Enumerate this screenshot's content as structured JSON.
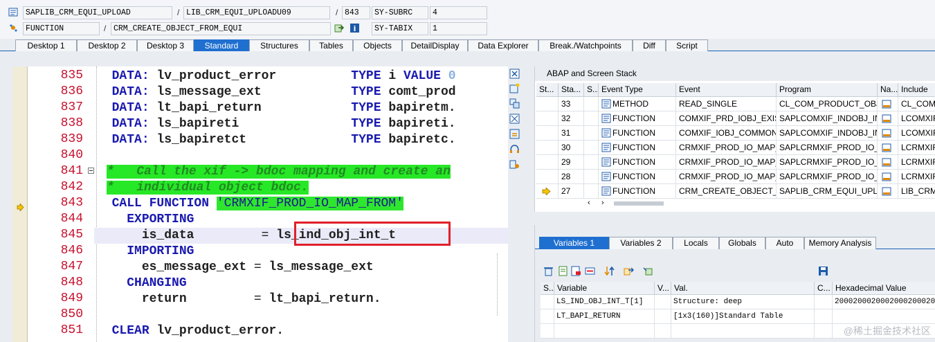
{
  "header": {
    "row1": {
      "program": "SAPLIB_CRM_EQUI_UPLOAD",
      "include": "LIB_CRM_EQUI_UPLOADU09",
      "line": "843",
      "sysfield": "SY-SUBRC",
      "sysvalue": "4",
      "sep1": "/",
      "sep2": "/"
    },
    "row2": {
      "event_type": "FUNCTION",
      "event": "CRM_CREATE_OBJECT_FROM_EQUI",
      "sysfield": "SY-TABIX",
      "sysvalue": "1",
      "sep1": "/"
    }
  },
  "tabs": [
    "Desktop 1",
    "Desktop 2",
    "Desktop 3",
    "Standard",
    "Structures",
    "Tables",
    "Objects",
    "DetailDisplay",
    "Data Explorer",
    "Break./Watchpoints",
    "Diff",
    "Script"
  ],
  "active_tab": "Standard",
  "editor": {
    "line_numbers": [
      "835",
      "836",
      "837",
      "838",
      "839",
      "840",
      "841",
      "842",
      "843",
      "844",
      "845",
      "846",
      "847",
      "848",
      "849",
      "850",
      "851"
    ],
    "current_line": "843",
    "code": {
      "l835": {
        "kw": "DATA:",
        "var": "lv_product_error",
        "kw2": "TYPE",
        "type": "i",
        "kw3": "VALUE",
        "val": "0"
      },
      "l836": {
        "kw": "DATA:",
        "var": "ls_message_ext",
        "kw2": "TYPE",
        "type": "comt_prod"
      },
      "l837": {
        "kw": "DATA:",
        "var": "lt_bapi_return",
        "kw2": "TYPE",
        "type": "bapiretm."
      },
      "l838": {
        "kw": "DATA:",
        "var": "ls_bapireti",
        "kw2": "TYPE",
        "type": "bapireti."
      },
      "l839": {
        "kw": "DATA:",
        "var": "ls_bapiretct",
        "kw2": "TYPE",
        "type": "bapiretc."
      },
      "l841": "*   Call the xif -> bdoc mapping and create an",
      "l842": "*   individual object bdoc.",
      "l843": {
        "kw": "CALL FUNCTION",
        "str": "'CRMXIF_PROD_IO_MAP_FROM'"
      },
      "l844": "EXPORTING",
      "l845": {
        "param": "is_data",
        "eq": "=",
        "val": "ls_ind_obj_int_t"
      },
      "l846": "IMPORTING",
      "l847": {
        "param": "es_message_ext",
        "eq": "=",
        "val": "ls_message_ext"
      },
      "l848": "CHANGING",
      "l849": {
        "param": "return",
        "eq": "=",
        "val": "lt_bapi_return."
      },
      "l851": {
        "kw": "CLEAR",
        "val": "lv_product_error."
      }
    }
  },
  "stack": {
    "title": "ABAP and Screen Stack",
    "columns": [
      "St...",
      "Sta...",
      "S...",
      "Event Type",
      "Event",
      "Program",
      "Na...",
      "Include"
    ],
    "rows": [
      {
        "level": "33",
        "event_type": "METHOD",
        "event": "READ_SINGLE",
        "program": "CL_COM_PRODUCT_OBJ...",
        "include": "CL_COM_..."
      },
      {
        "level": "32",
        "event_type": "FUNCTION",
        "event": "COMXIF_PRD_IOBJ_EXIS...",
        "program": "SAPLCOMXIF_INDOBJ_IN...",
        "include": "LCOMXIF..."
      },
      {
        "level": "31",
        "event_type": "FUNCTION",
        "event": "COMXIF_IOBJ_COMMON...",
        "program": "SAPLCOMXIF_INDOBJ_IN...",
        "include": "LCOMXIF..."
      },
      {
        "level": "30",
        "event_type": "FUNCTION",
        "event": "CRMXIF_PROD_IO_MAP_...",
        "program": "SAPLCRMXIF_PROD_IO_I...",
        "include": "LCRMXIF..."
      },
      {
        "level": "29",
        "event_type": "FUNCTION",
        "event": "CRMXIF_PROD_IO_MAP_...",
        "program": "SAPLCRMXIF_PROD_IO_I...",
        "include": "LCRMXIF..."
      },
      {
        "level": "28",
        "event_type": "FUNCTION",
        "event": "CRMXIF_PROD_IO_MAP_...",
        "program": "SAPLCRMXIF_PROD_IO_...",
        "include": "LCRMXIF..."
      },
      {
        "level": "27",
        "event_type": "FUNCTION",
        "event": "CRM_CREATE_OBJECT_F...",
        "program": "SAPLIB_CRM_EQUI_UPL...",
        "include": "LIB_CRM_..."
      }
    ],
    "current_row": "27"
  },
  "variables": {
    "tabs": [
      "Variables 1",
      "Variables 2",
      "Locals",
      "Globals",
      "Auto",
      "Memory Analysis"
    ],
    "active_tab": "Variables 1",
    "columns": [
      "S...",
      "Variable",
      "V...",
      "Val.",
      "C...",
      "Hexadecimal Value"
    ],
    "rows": [
      {
        "variable": "LS_IND_OBJ_INT_T[1]",
        "value": "Structure: deep",
        "hex": "20002000200020002000200"
      },
      {
        "variable": "LT_BAPI_RETURN",
        "value": "[1x3(160)]Standard Table",
        "hex": ""
      }
    ]
  },
  "watermark": "@稀土掘金技术社区",
  "colors": {
    "accent": "#1f6fd0",
    "line_number": "#c8102e",
    "comment_bg": "#26e826",
    "highlight_box": "#e0202a"
  }
}
